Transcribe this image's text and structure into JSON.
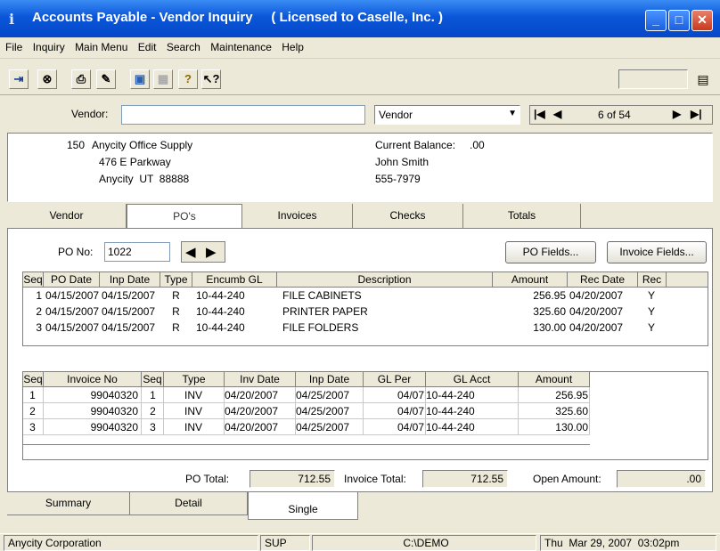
{
  "window": {
    "title": "Accounts Payable - Vendor Inquiry     ( Licensed to Caselle, Inc. )"
  },
  "menu": [
    "File",
    "Inquiry",
    "Main Menu",
    "Edit",
    "Search",
    "Maintenance",
    "Help"
  ],
  "toolbar": {
    "icons": [
      "exit-icon",
      "find-icon",
      "print-icon",
      "edit-icon",
      "preview-icon",
      "disabled-icon",
      "help-icon",
      "context-help-icon"
    ]
  },
  "vendor_search": {
    "label": "Vendor:",
    "value": "",
    "sort_by": "Vendor",
    "record_position": "6 of 54"
  },
  "vendor_info": {
    "number": "150",
    "name": "Anycity Office Supply",
    "address1": "476 E Parkway",
    "address2": "Anycity  UT  88888",
    "balance_label": "Current Balance:",
    "balance_value": ".00",
    "contact": "John Smith",
    "phone": "555-7979"
  },
  "tabs_top": [
    "Vendor",
    "PO's",
    "Invoices",
    "Checks",
    "Totals"
  ],
  "po": {
    "label": "PO No:",
    "value": "1022",
    "po_fields_button": "PO Fields...",
    "invoice_fields_button": "Invoice Fields..."
  },
  "po_grid": {
    "columns": [
      "Seq",
      "PO Date",
      "Inp Date",
      "Type",
      "Encumb GL",
      "Description",
      "Amount",
      "Rec Date",
      "Rec"
    ],
    "rows": [
      [
        "1",
        "04/15/2007",
        "04/15/2007",
        "R",
        "10-44-240",
        "FILE CABINETS",
        "256.95",
        "04/20/2007",
        "Y"
      ],
      [
        "2",
        "04/15/2007",
        "04/15/2007",
        "R",
        "10-44-240",
        "PRINTER PAPER",
        "325.60",
        "04/20/2007",
        "Y"
      ],
      [
        "3",
        "04/15/2007",
        "04/15/2007",
        "R",
        "10-44-240",
        "FILE FOLDERS",
        "130.00",
        "04/20/2007",
        "Y"
      ]
    ]
  },
  "invoice_grid": {
    "columns": [
      "Seq",
      "Invoice No",
      "Seq",
      "Type",
      "Inv Date",
      "Inp Date",
      "GL Per",
      "GL Acct",
      "Amount"
    ],
    "rows": [
      [
        "1",
        "99040320",
        "1",
        "INV",
        "04/20/2007",
        "04/25/2007",
        "04/07",
        "10-44-240",
        "256.95"
      ],
      [
        "2",
        "99040320",
        "2",
        "INV",
        "04/20/2007",
        "04/25/2007",
        "04/07",
        "10-44-240",
        "325.60"
      ],
      [
        "3",
        "99040320",
        "3",
        "INV",
        "04/20/2007",
        "04/25/2007",
        "04/07",
        "10-44-240",
        "130.00"
      ]
    ]
  },
  "totals": {
    "po_total_label": "PO Total:",
    "po_total": "712.55",
    "invoice_total_label": "Invoice Total:",
    "invoice_total": "712.55",
    "open_amount_label": "Open Amount:",
    "open_amount": ".00"
  },
  "tabs_bottom": [
    "Summary",
    "Detail",
    "Single"
  ],
  "status": {
    "company": "Anycity Corporation",
    "module": "SUP",
    "path": "C:\\DEMO",
    "datetime": "Thu  Mar 29, 2007  03:02pm"
  }
}
